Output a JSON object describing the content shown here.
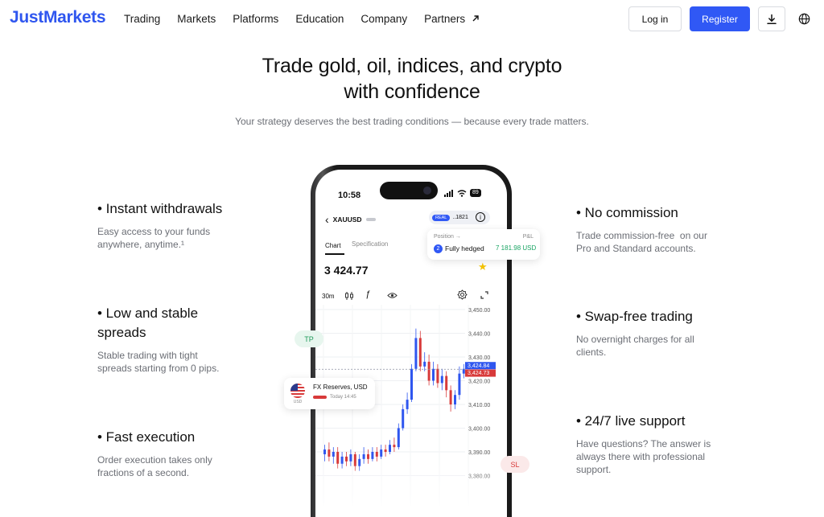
{
  "header": {
    "logo": "JustMarkets",
    "nav": [
      "Trading",
      "Markets",
      "Platforms",
      "Education",
      "Company",
      "Partners"
    ],
    "partners_icon": "arrow-up-right-icon",
    "login": "Log in",
    "register": "Register",
    "download_icon": "download-icon",
    "globe_icon": "globe-icon"
  },
  "hero": {
    "title_line1": "Trade gold, oil, indices, and crypto",
    "title_line2": "with confidence",
    "subtitle": "Your strategy deserves the best trading conditions — because every trade matters."
  },
  "features_left": [
    {
      "title": "• Instant withdrawals",
      "desc_line1": "Easy access to your funds",
      "desc_line2": "anywhere, anytime.¹"
    },
    {
      "title_line1": "• Low and stable",
      "title_line2": "spreads",
      "desc_line1": "Stable trading with tight",
      "desc_line2": "spreads starting from 0 pips."
    },
    {
      "title": "• Fast execution",
      "desc_line1": "Order execution takes only",
      "desc_line2": "fractions of a second."
    }
  ],
  "features_right": [
    {
      "title": "• No commission",
      "desc_line1": "Trade commission-free  on our",
      "desc_line2": "Pro and Standard accounts."
    },
    {
      "title": "• Swap-free trading",
      "desc_line1": "No overnight charges for all",
      "desc_line2": "clients."
    },
    {
      "title": "• 24/7 live support",
      "desc_line1": "Have questions? The answer is",
      "desc_line2": "always there with professional",
      "desc_line3": "support."
    }
  ],
  "phone": {
    "time": "10:58",
    "battery": "89",
    "symbol": "XAUUSD",
    "account_badge": "REAL",
    "account_id": "..1821",
    "tabs": [
      "Chart",
      "Specification"
    ],
    "price": "3 424.77",
    "timeframe": "30m",
    "price_ticks": [
      "3,450.00",
      "3,440.00",
      "3,430.00",
      "3,420.00",
      "3,410.00",
      "3,400.00",
      "3,390.00",
      "3,380.00"
    ],
    "ask_label": "3,424.84",
    "bid_label": "3,424.73",
    "tp_label": "TP",
    "sl_label": "SL",
    "position_card": {
      "label": "Position →",
      "pl_label": "P&L",
      "badge": "2",
      "status": "Fully hedged",
      "value": "7 181.98 USD"
    },
    "news_card": {
      "title": "FX Reserves, USD",
      "flag_label": "USD",
      "time": "Today 14:45"
    }
  },
  "colors": {
    "brand": "#2f56ef",
    "register": "#3058f5",
    "bull": "#2f56ef",
    "bear": "#d83a3a",
    "profit": "#19a463"
  }
}
